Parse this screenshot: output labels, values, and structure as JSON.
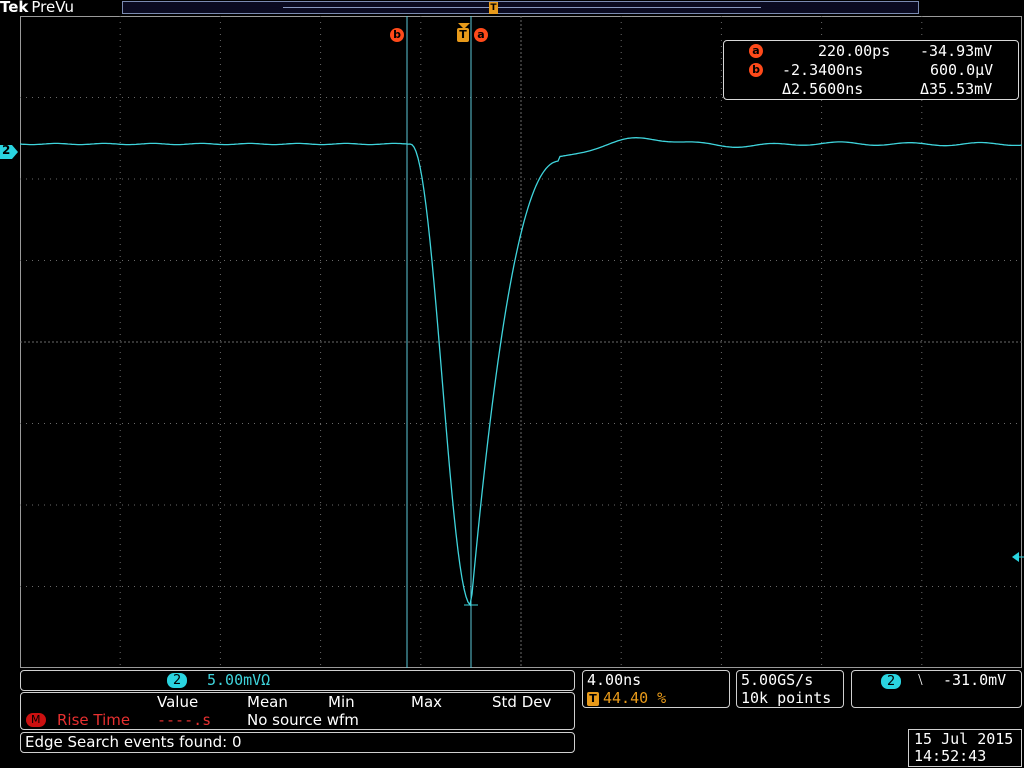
{
  "brand": {
    "maker": "Tek",
    "mode": "PreVu"
  },
  "record_marker": "T",
  "waveform": {
    "channel": "2",
    "color": "#3fd4dc",
    "baseline_mV": 0,
    "min_mV": -34.93,
    "min_time_ns": 0.22
  },
  "cursors": {
    "a": {
      "tag": "a",
      "time": "220.00ps",
      "value": "-34.93mV"
    },
    "b": {
      "tag": "b",
      "time": "-2.3400ns",
      "value": "600.0µV"
    },
    "delta_time": "Δ2.5600ns",
    "delta_value": "Δ35.53mV"
  },
  "trigger_tag": "T",
  "channel_marker": "2",
  "scale": {
    "channel": "2",
    "value": "5.00mVΩ"
  },
  "measurement": {
    "headers": [
      "Value",
      "Mean",
      "Min",
      "Max",
      "Std Dev"
    ],
    "badge": "M",
    "label": "Rise Time",
    "value": "----.s",
    "note": "No source wfm"
  },
  "edge_search": "Edge Search events found: 0",
  "horizontal": {
    "scale": "4.00ns",
    "trigger_tag": "T",
    "position": "44.40 %"
  },
  "acquisition": {
    "rate": "5.00GS/s",
    "points": "10k points"
  },
  "trigger": {
    "channel": "2",
    "slope": "⧵",
    "slope_icon": "falling-edge-icon",
    "level": "-31.0mV"
  },
  "datetime": {
    "date": "15 Jul  2015",
    "time": "14:52:43"
  },
  "colors": {
    "trace": "#3fd4dc",
    "cursor": "#ff4a1a",
    "trigger": "#e89a1a",
    "measure": "#ff3030"
  }
}
